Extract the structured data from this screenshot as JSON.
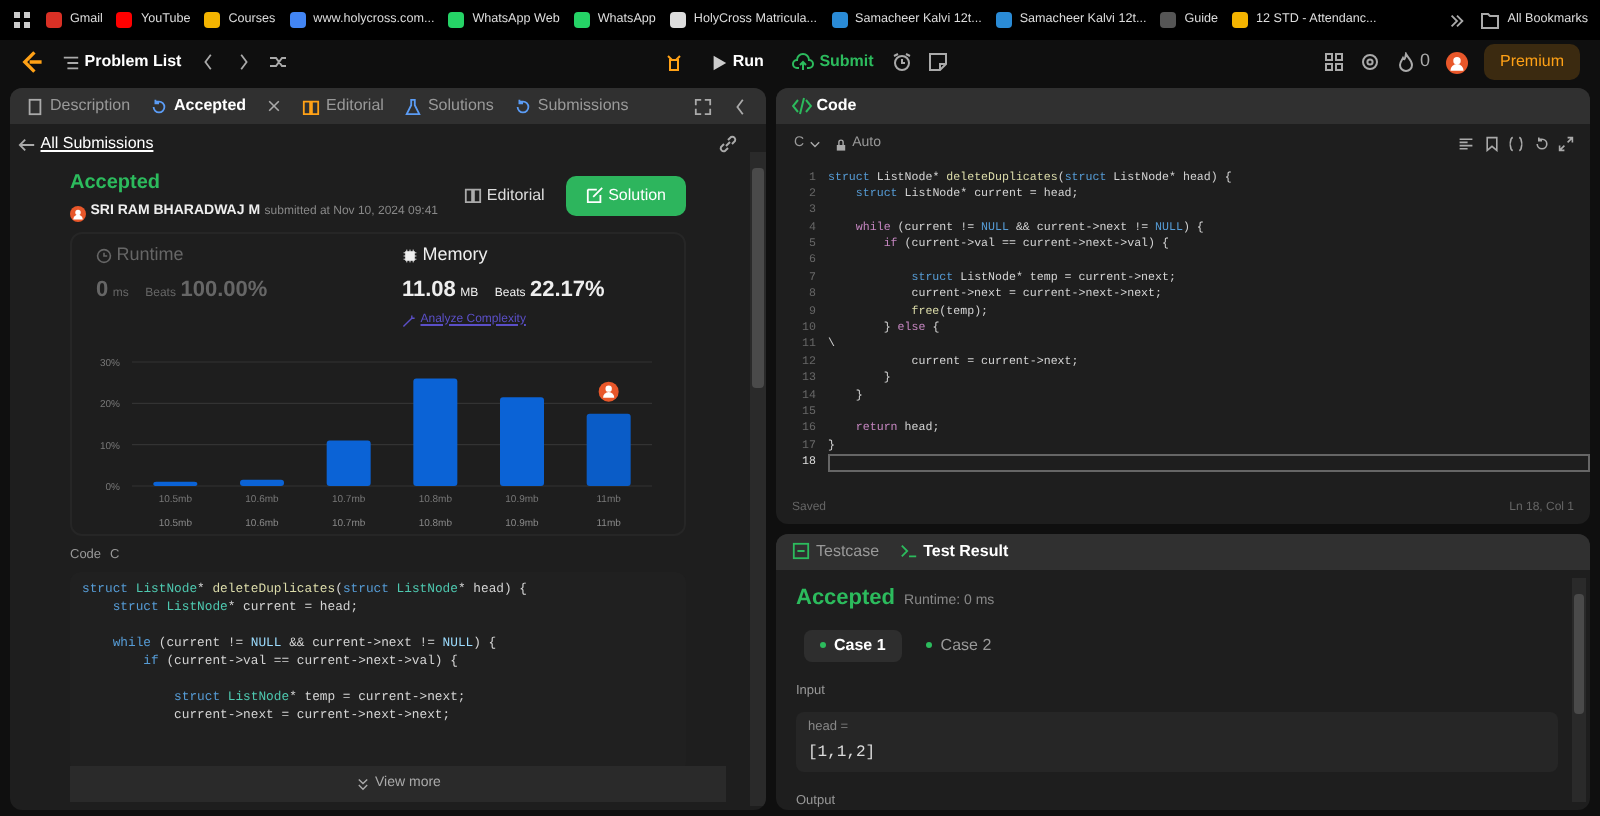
{
  "bookmarks": [
    {
      "label": "Gmail",
      "color": "#d93025"
    },
    {
      "label": "YouTube",
      "color": "#ff0000"
    },
    {
      "label": "Courses",
      "color": "#f4b400"
    },
    {
      "label": "www.holycross.com...",
      "color": "#4285f4"
    },
    {
      "label": "WhatsApp Web",
      "color": "#25d366"
    },
    {
      "label": "WhatsApp",
      "color": "#25d366"
    },
    {
      "label": "HolyCross Matricula...",
      "color": "#dddddd"
    },
    {
      "label": "Samacheer Kalvi 12t...",
      "color": "#2a8bd6"
    },
    {
      "label": "Samacheer Kalvi 12t...",
      "color": "#2a8bd6"
    },
    {
      "label": "Guide",
      "color": "#555555"
    },
    {
      "label": "12 STD - Attendanc...",
      "color": "#f4b400"
    }
  ],
  "all_bookmarks": "All Bookmarks",
  "nav": {
    "problem_list": "Problem List",
    "run": "Run",
    "submit": "Submit",
    "streak": "0",
    "premium": "Premium"
  },
  "tabs": [
    {
      "label": "Description",
      "selected": false,
      "closable": false
    },
    {
      "label": "Accepted",
      "selected": true,
      "closable": true
    },
    {
      "label": "Editorial",
      "selected": false,
      "closable": false
    },
    {
      "label": "Solutions",
      "selected": false,
      "closable": false
    },
    {
      "label": "Submissions",
      "selected": false,
      "closable": false
    }
  ],
  "submission": {
    "back": "All Submissions",
    "status": "Accepted",
    "user": "SRI RAM BHARADWAJ M",
    "submitted": "submitted at Nov 10, 2024 09:41",
    "editorial": "Editorial",
    "solution": "Solution",
    "metrics": [
      {
        "title": "Runtime",
        "value": "0",
        "unit": "ms",
        "beats_label": "Beats",
        "beats": "100.00%",
        "selected": false
      },
      {
        "title": "Memory",
        "value": "11.08",
        "unit": "MB",
        "beats_label": "Beats",
        "beats": "22.17%",
        "selected": true
      }
    ],
    "analyze": "Analyze Complexity",
    "chart_data": {
      "type": "bar",
      "categories": [
        "10.5mb",
        "10.6mb",
        "10.7mb",
        "10.8mb",
        "10.9mb",
        "11mb"
      ],
      "values": [
        1,
        1.5,
        11,
        26,
        21.5,
        17.5
      ],
      "ylim": [
        0,
        30
      ],
      "yticks": [
        {
          "value": 0,
          "label": "0%"
        },
        {
          "value": 10,
          "label": "10%"
        },
        {
          "value": 20,
          "label": "20%"
        },
        {
          "value": 30,
          "label": "30%"
        }
      ]
    },
    "range_labels": [
      "10.5mb",
      "10.6mb",
      "10.7mb",
      "10.8mb",
      "10.9mb",
      "11mb"
    ],
    "code_label": "Code",
    "code_lang": "C",
    "code": [
      {
        "kind": "code",
        "segments": [
          {
            "text": "struct ",
            "kind": "kw"
          },
          {
            "text": "ListNode",
            "kind": "type"
          },
          {
            "text": "* ",
            "kind": "plain"
          },
          {
            "text": "deleteDuplicates",
            "kind": "fn"
          },
          {
            "text": "(",
            "kind": "plain"
          },
          {
            "text": "struct ",
            "kind": "kw"
          },
          {
            "text": "ListNode",
            "kind": "type"
          },
          {
            "text": "* head) {",
            "kind": "plain"
          }
        ]
      },
      {
        "kind": "code",
        "segments": [
          {
            "text": "    struct ",
            "kind": "kw"
          },
          {
            "text": "ListNode",
            "kind": "type"
          },
          {
            "text": "* current = head;",
            "kind": "plain"
          }
        ]
      },
      {
        "kind": "blank"
      },
      {
        "kind": "code",
        "segments": [
          {
            "text": "    while ",
            "kind": "kw"
          },
          {
            "text": "(current != ",
            "kind": "plain"
          },
          {
            "text": "NULL",
            "kind": "const"
          },
          {
            "text": " && current->next != ",
            "kind": "plain"
          },
          {
            "text": "NULL",
            "kind": "const"
          },
          {
            "text": ") {",
            "kind": "plain"
          }
        ]
      },
      {
        "kind": "code",
        "segments": [
          {
            "text": "        if ",
            "kind": "kw"
          },
          {
            "text": "(current->val == current->next->val) {",
            "kind": "plain"
          }
        ]
      },
      {
        "kind": "blank"
      },
      {
        "kind": "code",
        "segments": [
          {
            "text": "            struct ",
            "kind": "kw"
          },
          {
            "text": "ListNode",
            "kind": "type"
          },
          {
            "text": "* temp = current->next;",
            "kind": "plain"
          }
        ]
      },
      {
        "kind": "code",
        "segments": [
          {
            "text": "            current->next = current->next->next;",
            "kind": "plain"
          }
        ]
      }
    ],
    "view_more": "View more"
  },
  "editor": {
    "title": "Code",
    "language": "C",
    "mode": "Auto",
    "lines": [
      {
        "number": "1",
        "current": false,
        "segments": [
          {
            "text": "struct ",
            "kind": "kw"
          },
          {
            "text": "ListNode* ",
            "kind": "plain"
          },
          {
            "text": "deleteDuplicates",
            "kind": "fn"
          },
          {
            "text": "(",
            "kind": "plain"
          },
          {
            "text": "struct ",
            "kind": "kw"
          },
          {
            "text": "ListNode* head) {",
            "kind": "plain"
          }
        ]
      },
      {
        "number": "2",
        "current": false,
        "segments": [
          {
            "text": "    struct ",
            "kind": "kw"
          },
          {
            "text": "ListNode* current = head;",
            "kind": "plain"
          }
        ]
      },
      {
        "number": "3",
        "current": false
      },
      {
        "number": "4",
        "current": false,
        "segments": [
          {
            "text": "    while ",
            "kind": "ctl"
          },
          {
            "text": "(current != ",
            "kind": "plain"
          },
          {
            "text": "NULL",
            "kind": "kw"
          },
          {
            "text": " && current->next != ",
            "kind": "plain"
          },
          {
            "text": "NULL",
            "kind": "kw"
          },
          {
            "text": ") {",
            "kind": "plain"
          }
        ]
      },
      {
        "number": "5",
        "current": false,
        "segments": [
          {
            "text": "        if ",
            "kind": "ctl"
          },
          {
            "text": "(current->val == current->next->val) {",
            "kind": "plain"
          }
        ]
      },
      {
        "number": "6",
        "current": false
      },
      {
        "number": "7",
        "current": false,
        "segments": [
          {
            "text": "            struct ",
            "kind": "kw"
          },
          {
            "text": "ListNode* temp = current->next;",
            "kind": "plain"
          }
        ]
      },
      {
        "number": "8",
        "current": false,
        "segments": [
          {
            "text": "            current->next = current->next->next;",
            "kind": "plain"
          }
        ]
      },
      {
        "number": "9",
        "current": false,
        "segments": [
          {
            "text": "            free",
            "kind": "fn"
          },
          {
            "text": "(temp);",
            "kind": "plain"
          }
        ]
      },
      {
        "number": "10",
        "current": false,
        "segments": [
          {
            "text": "        } ",
            "kind": "plain"
          },
          {
            "text": "else",
            "kind": "ctl"
          },
          {
            "text": " {",
            "kind": "plain"
          }
        ]
      },
      {
        "number": "11",
        "current": false,
        "segments": [
          {
            "text": "\\",
            "kind": "plain"
          }
        ]
      },
      {
        "number": "12",
        "current": false,
        "segments": [
          {
            "text": "            current = current->next;",
            "kind": "plain"
          }
        ]
      },
      {
        "number": "13",
        "current": false,
        "segments": [
          {
            "text": "        }",
            "kind": "plain"
          }
        ]
      },
      {
        "number": "14",
        "current": false,
        "segments": [
          {
            "text": "    }",
            "kind": "plain"
          }
        ]
      },
      {
        "number": "15",
        "current": false
      },
      {
        "number": "16",
        "current": false,
        "segments": [
          {
            "text": "    return ",
            "kind": "ctl"
          },
          {
            "text": "head;",
            "kind": "plain"
          }
        ]
      },
      {
        "number": "17",
        "current": false,
        "segments": [
          {
            "text": "}",
            "kind": "plain"
          }
        ]
      },
      {
        "number": "18",
        "current": true
      }
    ],
    "saved": "Saved",
    "position": "Ln 18, Col 1"
  },
  "console": {
    "tabs": [
      {
        "label": "Testcase",
        "selected": false
      },
      {
        "label": "Test Result",
        "selected": true
      }
    ],
    "status": "Accepted",
    "runtime": "Runtime: 0 ms",
    "cases": [
      {
        "label": "Case 1",
        "selected": true
      },
      {
        "label": "Case 2",
        "selected": false
      }
    ],
    "input_label": "Input",
    "param": "head =",
    "param_value": "[1,1,2]",
    "output_label": "Output"
  }
}
